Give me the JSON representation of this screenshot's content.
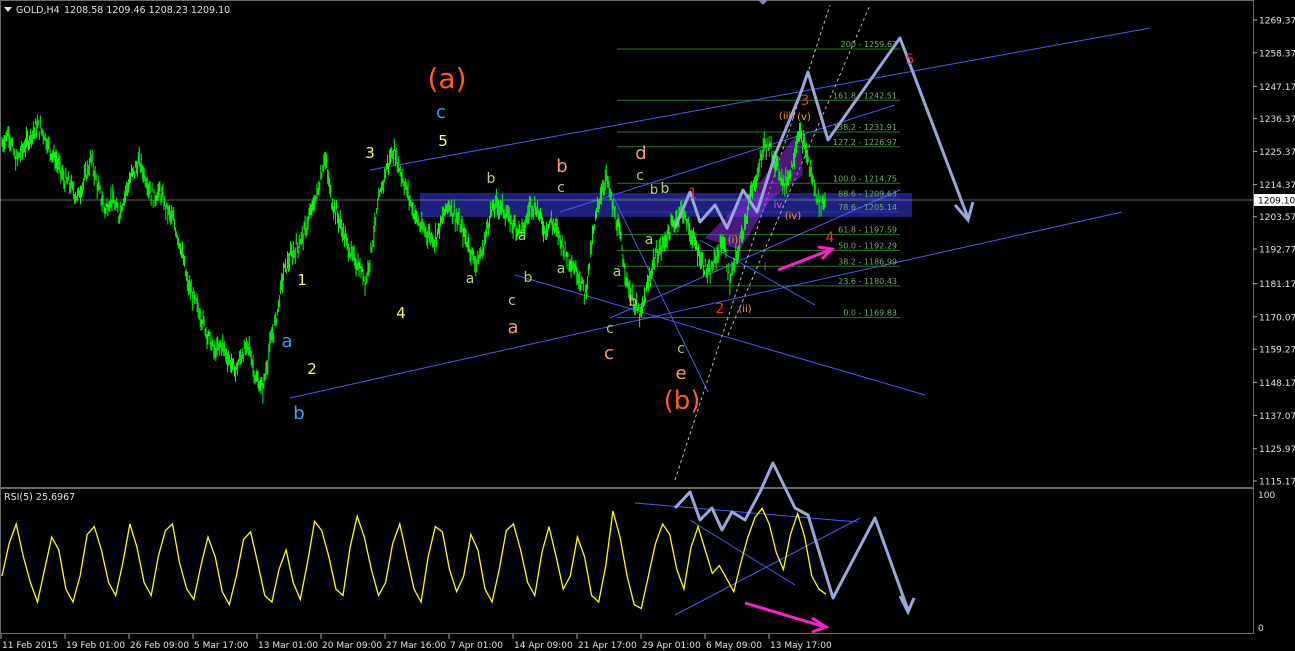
{
  "header": {
    "symbol_title": "GOLD,H4",
    "ohlc": "1208.58 1209.46 1208.23 1209.10"
  },
  "indicator": {
    "title": "RSI(5) 25.6967",
    "axis_top": "100",
    "axis_bottom": "0"
  },
  "colors": {
    "background": "#000000",
    "candles": "#00ff00",
    "rsi_line": "#ffff00",
    "channel": "#4a5aff",
    "fib": "#2a7a2a",
    "arrows": "#9aa6dd",
    "magenta": "#ff22cc",
    "zone": "#2a2aa8"
  },
  "chart_data": [
    {
      "type": "line",
      "title": "GOLD,H4",
      "ylim": [
        1112,
        1275
      ],
      "y_ticks": [
        "1269.37",
        "1258.37",
        "1247.17",
        "1236.37",
        "1225.37",
        "1214.37",
        "1203.57",
        "1192.77",
        "1181.17",
        "1170.07",
        "1159.27",
        "1148.17",
        "1137.07",
        "1125.97",
        "1115.17"
      ],
      "current_price": "1209.10",
      "x_ticks": [
        "11 Feb 2015",
        "19 Feb 01:00",
        "26 Feb 09:00",
        "5 Mar 17:00",
        "13 Mar 01:00",
        "20 Mar 09:00",
        "27 Mar 16:00",
        "7 Apr 01:00",
        "14 Apr 09:00",
        "21 Apr 17:00",
        "29 Apr 01:00",
        "6 May 09:00",
        "13 May 17:00"
      ],
      "close_path": [
        1228,
        1232,
        1222,
        1226,
        1230,
        1234,
        1232,
        1226,
        1222,
        1216,
        1214,
        1210,
        1216,
        1223,
        1213,
        1206,
        1210,
        1204,
        1212,
        1218,
        1222,
        1216,
        1210,
        1212,
        1206,
        1202,
        1194,
        1181,
        1176,
        1170,
        1164,
        1158,
        1161,
        1156,
        1152,
        1158,
        1160,
        1149,
        1146,
        1160,
        1170,
        1185,
        1190,
        1194,
        1198,
        1205,
        1212,
        1224,
        1209,
        1203,
        1196,
        1190,
        1187,
        1182,
        1196,
        1210,
        1220,
        1226,
        1219,
        1212,
        1205,
        1200,
        1198,
        1196,
        1202,
        1208,
        1204,
        1199,
        1194,
        1188,
        1192,
        1204,
        1208,
        1206,
        1202,
        1200,
        1199,
        1208,
        1206,
        1199,
        1202,
        1198,
        1192,
        1188,
        1184,
        1178,
        1196,
        1210,
        1217,
        1206,
        1197,
        1182,
        1175,
        1170,
        1180,
        1190,
        1193,
        1198,
        1202,
        1206,
        1200,
        1194,
        1188,
        1184,
        1190,
        1196,
        1182,
        1190,
        1200,
        1210,
        1218,
        1228,
        1226,
        1220,
        1214,
        1220,
        1232,
        1226,
        1216,
        1208,
        1209
      ],
      "fib_levels": [
        {
          "label": "200 - 1259.67",
          "price": 1259.67
        },
        {
          "label": "161.8 - 1242.51",
          "price": 1242.51
        },
        {
          "label": "138.2 - 1231.91",
          "price": 1231.91
        },
        {
          "label": "127.2 - 1226.97",
          "price": 1226.97
        },
        {
          "label": "100.0 - 1214.75",
          "price": 1214.75
        },
        {
          "label": "88.6 - 1209.63",
          "price": 1209.63
        },
        {
          "label": "78.6 - 1205.14",
          "price": 1205.14
        },
        {
          "label": "61.8 - 1197.59",
          "price": 1197.59
        },
        {
          "label": "50.0 - 1192.29",
          "price": 1192.29
        },
        {
          "label": "38.2 - 1186.99",
          "price": 1186.99
        },
        {
          "label": "23.6 - 1180.43",
          "price": 1180.43
        },
        {
          "label": "0.0 - 1169.83",
          "price": 1169.83
        }
      ],
      "wave_labels": [
        {
          "text": "(a)",
          "color": "#ff5a28"
        },
        {
          "text": "c",
          "color": "#29a8ff"
        },
        {
          "text": "5",
          "color": "#ffff55"
        },
        {
          "text": "3",
          "color": "#ffff55"
        },
        {
          "text": "1",
          "color": "#ffff55"
        },
        {
          "text": "2",
          "color": "#ffff55"
        },
        {
          "text": "4",
          "color": "#ffff55"
        },
        {
          "text": "a",
          "color": "#29a8ff"
        },
        {
          "text": "b",
          "color": "#29a8ff"
        },
        {
          "text": "b",
          "color": "#b6d36a"
        },
        {
          "text": "a",
          "color": "#b6d36a"
        },
        {
          "text": "a",
          "color": "#b6d36a"
        },
        {
          "text": "b",
          "color": "#b6d36a"
        },
        {
          "text": "c",
          "color": "#b6d36a"
        },
        {
          "text": "c",
          "color": "#b6d36a"
        },
        {
          "text": "a",
          "color": "#b6d36a"
        },
        {
          "text": "b",
          "color": "#ff9a72"
        },
        {
          "text": "a",
          "color": "#ff9a72"
        },
        {
          "text": "c",
          "color": "#ff9a72"
        },
        {
          "text": "d",
          "color": "#ff9a72"
        },
        {
          "text": "c",
          "color": "#b6d36a"
        },
        {
          "text": "b",
          "color": "#b6d36a"
        },
        {
          "text": "a",
          "color": "#b6d36a"
        },
        {
          "text": "a",
          "color": "#b6d36a"
        },
        {
          "text": "b",
          "color": "#b6d36a"
        },
        {
          "text": "b",
          "color": "#b6d36a"
        },
        {
          "text": "c",
          "color": "#b6d36a"
        },
        {
          "text": "c",
          "color": "#b6d36a"
        },
        {
          "text": "e",
          "color": "#ff9a72"
        },
        {
          "text": "(b)",
          "color": "#ff5a28"
        },
        {
          "text": "1",
          "color": "#ff2a2a"
        },
        {
          "text": "2",
          "color": "#ff2a2a"
        },
        {
          "text": "3",
          "color": "#ff2a2a"
        },
        {
          "text": "4",
          "color": "#ff2a2a"
        },
        {
          "text": "5",
          "color": "#ff2a2a"
        },
        {
          "text": "(i)",
          "color": "#ff9a40"
        },
        {
          "text": "(ii)",
          "color": "#ff9a40"
        },
        {
          "text": "(iii)",
          "color": "#ff9a40"
        },
        {
          "text": "(iv)",
          "color": "#ff9a40"
        },
        {
          "text": "(v)",
          "color": "#ff9a40"
        },
        {
          "text": "i",
          "color": "#ee44ee"
        },
        {
          "text": "ii",
          "color": "#ee44ee"
        },
        {
          "text": "iv",
          "color": "#ee44ee"
        },
        {
          "text": "b",
          "color": "#29a8ff"
        }
      ]
    },
    {
      "type": "line",
      "title": "RSI(5) 25.6967",
      "ylim": [
        0,
        100
      ],
      "y_ticks": [
        "100",
        "0"
      ],
      "values": [
        40,
        65,
        80,
        55,
        35,
        20,
        45,
        70,
        60,
        30,
        20,
        40,
        72,
        78,
        60,
        35,
        25,
        50,
        80,
        62,
        35,
        25,
        55,
        75,
        80,
        50,
        30,
        22,
        48,
        70,
        55,
        28,
        18,
        40,
        68,
        74,
        50,
        25,
        20,
        45,
        60,
        35,
        22,
        50,
        82,
        75,
        55,
        30,
        25,
        62,
        86,
        70,
        45,
        25,
        35,
        65,
        80,
        55,
        30,
        20,
        55,
        78,
        74,
        45,
        28,
        40,
        72,
        60,
        30,
        20,
        45,
        75,
        80,
        60,
        35,
        25,
        58,
        78,
        55,
        30,
        40,
        70,
        55,
        25,
        20,
        48,
        90,
        70,
        40,
        18,
        15,
        40,
        65,
        80,
        72,
        45,
        30,
        62,
        78,
        60,
        42,
        48,
        38,
        28,
        50,
        70,
        85,
        92,
        80,
        58,
        45,
        72,
        88,
        70,
        40,
        30,
        26
      ]
    }
  ]
}
